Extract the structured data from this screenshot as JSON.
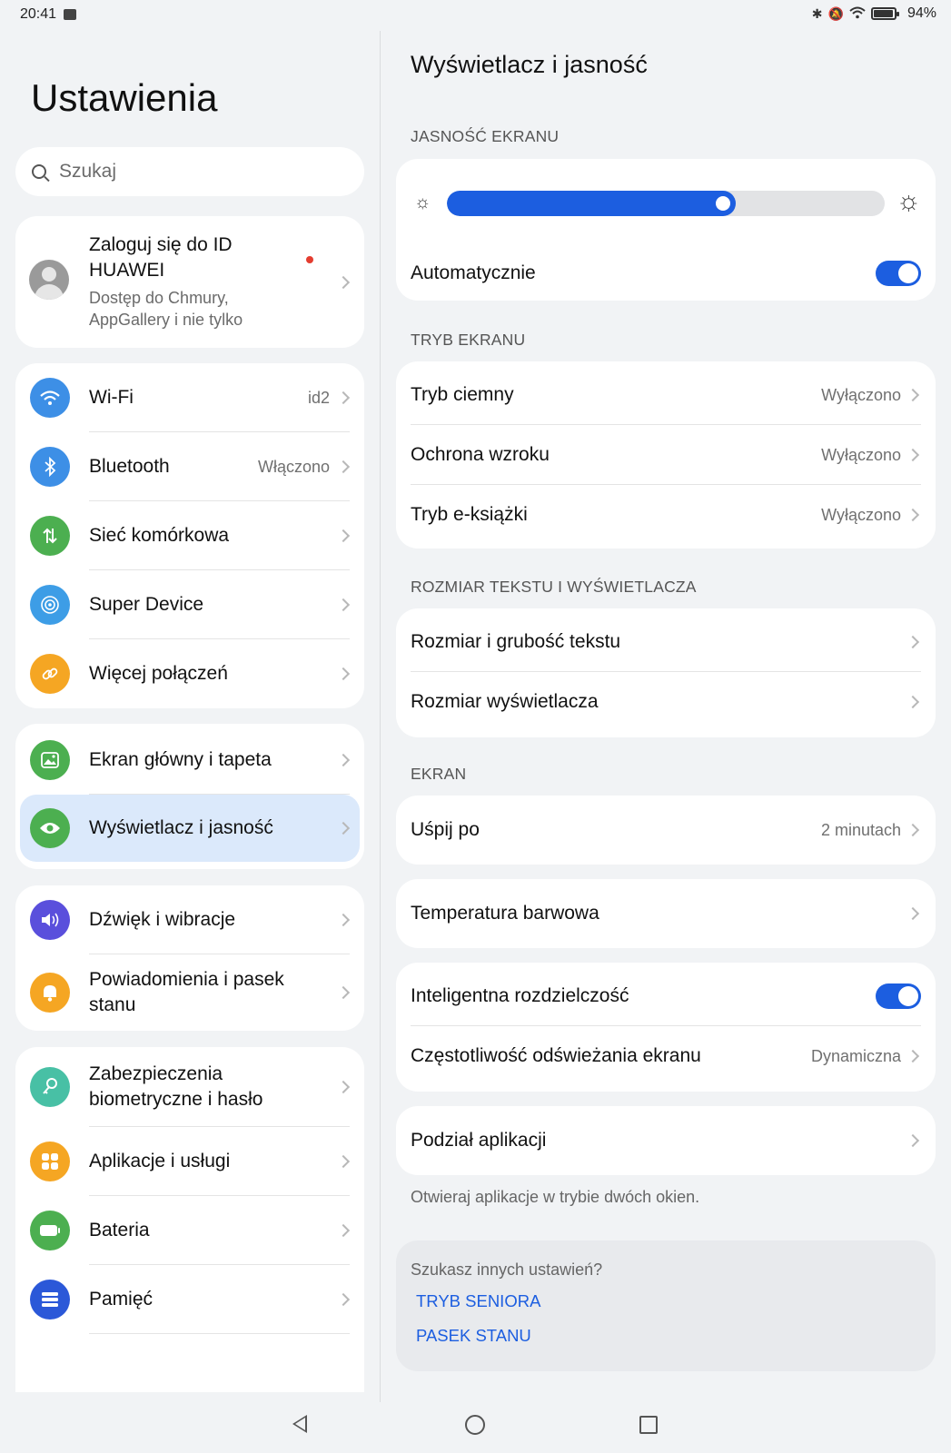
{
  "status_bar": {
    "time": "20:41",
    "battery": "94%"
  },
  "left": {
    "title": "Ustawienia",
    "search_placeholder": "Szukaj",
    "account": {
      "name": "Zaloguj się do ID HUAWEI",
      "subtitle": "Dostęp do Chmury, AppGallery i nie tylko"
    },
    "groups": [
      [
        {
          "label": "Wi-Fi",
          "value": "id2",
          "icon": "wifi-icon",
          "color": "#3d8fe6"
        },
        {
          "label": "Bluetooth",
          "value": "Włączono",
          "icon": "bluetooth-icon",
          "color": "#3d8fe6"
        },
        {
          "label": "Sieć komórkowa",
          "value": "",
          "icon": "cellular-icon",
          "color": "#4caf50"
        },
        {
          "label": "Super Device",
          "value": "",
          "icon": "super-device-icon",
          "color": "#3d9de6"
        },
        {
          "label": "Więcej połączeń",
          "value": "",
          "icon": "link-icon",
          "color": "#f5a623"
        }
      ],
      [
        {
          "label": "Ekran główny i tapeta",
          "value": "",
          "icon": "wallpaper-icon",
          "color": "#4caf50"
        },
        {
          "label": "Wyświetlacz i jasność",
          "value": "",
          "icon": "eye-icon",
          "color": "#4caf50",
          "selected": true
        }
      ],
      [
        {
          "label": "Dźwięk i wibracje",
          "value": "",
          "icon": "sound-icon",
          "color": "#5a4fdc"
        },
        {
          "label": "Powiadomienia i pasek stanu",
          "value": "",
          "icon": "bell-icon",
          "color": "#f5a623"
        }
      ],
      [
        {
          "label": "Zabezpieczenia biometryczne i hasło",
          "value": "",
          "icon": "key-icon",
          "color": "#48c0a5"
        },
        {
          "label": "Aplikacje i usługi",
          "value": "",
          "icon": "apps-icon",
          "color": "#f5a623"
        },
        {
          "label": "Bateria",
          "value": "",
          "icon": "battery-icon",
          "color": "#4caf50"
        },
        {
          "label": "Pamięć",
          "value": "",
          "icon": "storage-icon",
          "color": "#2b58d8"
        }
      ]
    ]
  },
  "right": {
    "title": "Wyświetlacz i jasność",
    "brightness": {
      "header": "JASNOŚĆ EKRANU",
      "level": 0.66,
      "auto_label": "Automatycznie",
      "auto_on": true
    },
    "screen_mode": {
      "header": "TRYB EKRANU",
      "items": [
        {
          "label": "Tryb ciemny",
          "value": "Wyłączono"
        },
        {
          "label": "Ochrona wzroku",
          "value": "Wyłączono"
        },
        {
          "label": "Tryb e-książki",
          "value": "Wyłączono"
        }
      ]
    },
    "text_size": {
      "header": "ROZMIAR TEKSTU I WYŚWIETLACZA",
      "items": [
        {
          "label": "Rozmiar i grubość tekstu"
        },
        {
          "label": "Rozmiar wyświetlacza"
        }
      ]
    },
    "screen": {
      "header": "EKRAN",
      "sleep": {
        "label": "Uśpij po",
        "value": "2 minutach"
      },
      "color_temp": {
        "label": "Temperatura barwowa"
      },
      "smart_resolution": {
        "label": "Inteligentna rozdzielczość",
        "on": true
      },
      "refresh_rate": {
        "label": "Częstotliwość odświeżania ekranu",
        "value": "Dynamiczna"
      },
      "app_split": {
        "label": "Podział aplikacji"
      },
      "app_split_hint": "Otwieraj aplikacje w trybie dwóch okien."
    },
    "more": {
      "question": "Szukasz innych ustawień?",
      "links": [
        "TRYB SENIORA",
        "PASEK STANU"
      ]
    }
  }
}
